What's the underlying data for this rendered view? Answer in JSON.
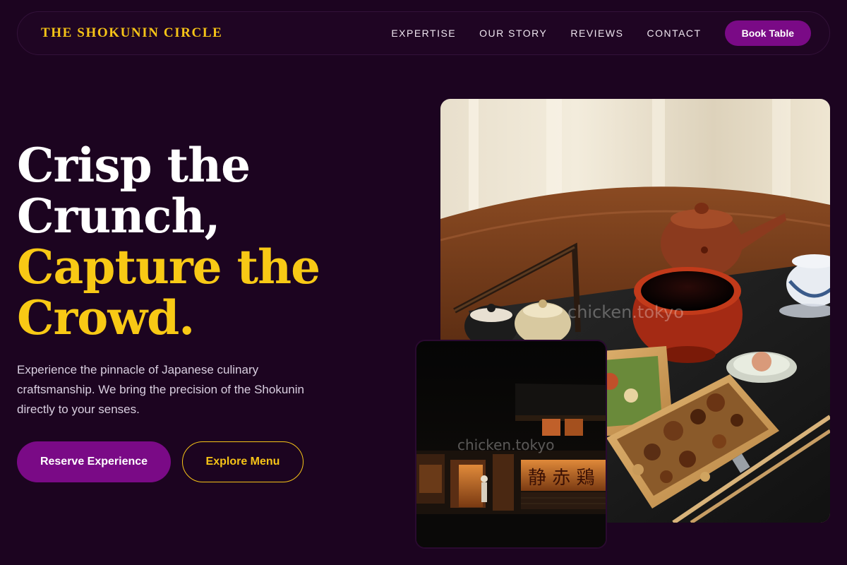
{
  "nav": {
    "brand": "THE SHOKUNIN CIRCLE",
    "links": [
      "EXPERTISE",
      "OUR STORY",
      "REVIEWS",
      "CONTACT"
    ],
    "cta": "Book Table"
  },
  "hero": {
    "title_lines": [
      "Crisp the",
      "Crunch,",
      "Capture the",
      "Crowd."
    ],
    "description": "Experience the pinnacle of Japanese culinary craftsmanship. We bring the precision of the Shokunin directly to your senses.",
    "primary_cta": "Reserve Experience",
    "secondary_cta": "Explore Menu"
  },
  "images": {
    "main_watermark": "chicken.tokyo",
    "small_watermark": "chicken.tokyo"
  },
  "colors": {
    "background": "#1c0420",
    "accent_purple": "#7a0a86",
    "accent_gold": "#f8c915"
  }
}
